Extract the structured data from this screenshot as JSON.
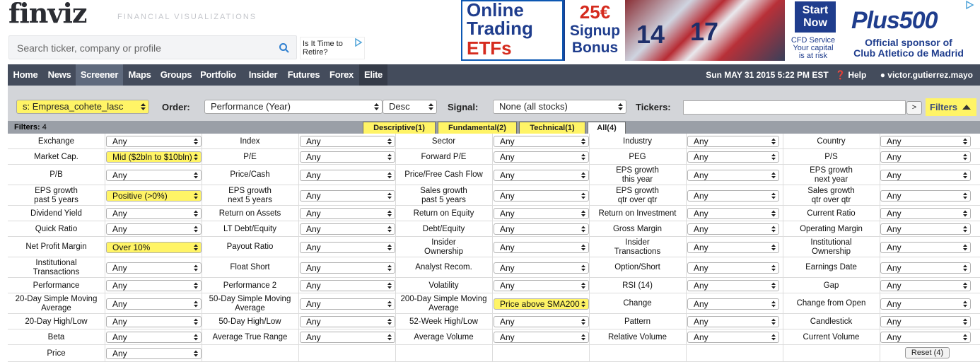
{
  "header": {
    "logo": "finviz",
    "tagline": "FINANCIAL VISUALIZATIONS",
    "search_placeholder": "Search ticker, company or profile",
    "small_ad_text": "Is It Time to Retire?"
  },
  "banner": {
    "line1": "Online",
    "line2": "Trading",
    "line3": "ETFs",
    "promo1": "25€",
    "promo2": "Signup",
    "promo3": "Bonus",
    "jersey1": "14",
    "jersey2": "17",
    "cta1": "Start",
    "cta2": "Now",
    "small1": "CFD Service",
    "small2": "Your capital",
    "small3": "is at risk",
    "brand": "Plus500",
    "sponsor1": "Official sponsor of",
    "sponsor2": "Club Atletico de Madrid"
  },
  "nav": {
    "items": [
      "Home",
      "News",
      "Screener",
      "Maps",
      "Groups",
      "Portfolio",
      "Insider",
      "Futures",
      "Forex",
      "Elite"
    ],
    "active": "Screener",
    "datetime": "Sun MAY 31 2015 5:22 PM EST",
    "help": "Help",
    "user": "victor.gutierrez.mayo"
  },
  "controls": {
    "preset": "s: Empresa_cohete_lasc",
    "order_label": "Order:",
    "order": "Performance (Year)",
    "direction": "Desc",
    "signal_label": "Signal:",
    "signal": "None (all stocks)",
    "tickers_label": "Tickers:",
    "go": ">",
    "filters_btn": "Filters"
  },
  "tabs": {
    "count_label": "Filters:",
    "count": "4",
    "items": [
      "Descriptive(1)",
      "Fundamental(2)",
      "Technical(1)",
      "All(4)"
    ]
  },
  "filters": [
    [
      [
        "Exchange",
        "Any"
      ],
      [
        "Index",
        "Any"
      ],
      [
        "Sector",
        "Any"
      ],
      [
        "Industry",
        "Any"
      ],
      [
        "Country",
        "Any"
      ]
    ],
    [
      [
        "Market Cap.",
        "Mid ($2bln to $10bln)"
      ],
      [
        "P/E",
        "Any"
      ],
      [
        "Forward P/E",
        "Any"
      ],
      [
        "PEG",
        "Any"
      ],
      [
        "P/S",
        "Any"
      ]
    ],
    [
      [
        "P/B",
        "Any"
      ],
      [
        "Price/Cash",
        "Any"
      ],
      [
        "Price/Free Cash Flow",
        "Any"
      ],
      [
        "EPS growth\nthis year",
        "Any"
      ],
      [
        "EPS growth\nnext year",
        "Any"
      ]
    ],
    [
      [
        "EPS growth\npast 5 years",
        "Positive (>0%)"
      ],
      [
        "EPS growth\nnext 5 years",
        "Any"
      ],
      [
        "Sales growth\npast 5 years",
        "Any"
      ],
      [
        "EPS growth\nqtr over qtr",
        "Any"
      ],
      [
        "Sales growth\nqtr over qtr",
        "Any"
      ]
    ],
    [
      [
        "Dividend Yield",
        "Any"
      ],
      [
        "Return on Assets",
        "Any"
      ],
      [
        "Return on Equity",
        "Any"
      ],
      [
        "Return on Investment",
        "Any"
      ],
      [
        "Current Ratio",
        "Any"
      ]
    ],
    [
      [
        "Quick Ratio",
        "Any"
      ],
      [
        "LT Debt/Equity",
        "Any"
      ],
      [
        "Debt/Equity",
        "Any"
      ],
      [
        "Gross Margin",
        "Any"
      ],
      [
        "Operating Margin",
        "Any"
      ]
    ],
    [
      [
        "Net Profit Margin",
        "Over 10%"
      ],
      [
        "Payout Ratio",
        "Any"
      ],
      [
        "Insider\nOwnership",
        "Any"
      ],
      [
        "Insider\nTransactions",
        "Any"
      ],
      [
        "Institutional\nOwnership",
        "Any"
      ]
    ],
    [
      [
        "Institutional\nTransactions",
        "Any"
      ],
      [
        "Float Short",
        "Any"
      ],
      [
        "Analyst Recom.",
        "Any"
      ],
      [
        "Option/Short",
        "Any"
      ],
      [
        "Earnings Date",
        "Any"
      ]
    ],
    [
      [
        "Performance",
        "Any"
      ],
      [
        "Performance 2",
        "Any"
      ],
      [
        "Volatility",
        "Any"
      ],
      [
        "RSI (14)",
        "Any"
      ],
      [
        "Gap",
        "Any"
      ]
    ],
    [
      [
        "20-Day Simple Moving\nAverage",
        "Any"
      ],
      [
        "50-Day Simple Moving\nAverage",
        "Any"
      ],
      [
        "200-Day Simple Moving\nAverage",
        "Price above SMA200"
      ],
      [
        "Change",
        "Any"
      ],
      [
        "Change from Open",
        "Any"
      ]
    ],
    [
      [
        "20-Day High/Low",
        "Any"
      ],
      [
        "50-Day High/Low",
        "Any"
      ],
      [
        "52-Week High/Low",
        "Any"
      ],
      [
        "Pattern",
        "Any"
      ],
      [
        "Candlestick",
        "Any"
      ]
    ],
    [
      [
        "Beta",
        "Any"
      ],
      [
        "Average True Range",
        "Any"
      ],
      [
        "Average Volume",
        "Any"
      ],
      [
        "Relative Volume",
        "Any"
      ],
      [
        "Current Volume",
        "Any"
      ]
    ],
    [
      [
        "Price",
        "Any"
      ]
    ]
  ],
  "reset": "Reset (4)"
}
